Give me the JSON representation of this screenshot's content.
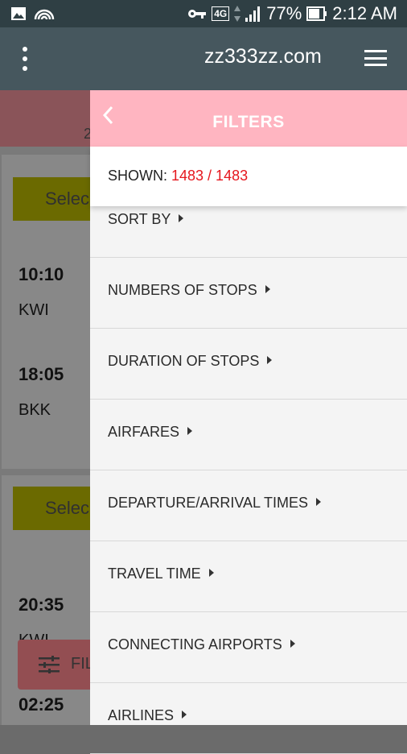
{
  "status_bar": {
    "battery": "77%",
    "time": "2:12 AM",
    "network": "4G"
  },
  "app_bar": {
    "title": "zz333zz.com"
  },
  "background": {
    "select_label": "Selec",
    "flights": [
      {
        "time": "10:10",
        "code": "KWI"
      },
      {
        "time": "18:05",
        "code": "BKK"
      },
      {
        "time": "20:35",
        "code": "KWI"
      },
      {
        "time": "02:25",
        "code": ""
      }
    ],
    "fab_label": "FIL",
    "date_fragment": "2"
  },
  "drawer": {
    "title": "FILTERS",
    "shown_label": "SHOWN:",
    "shown_value": "1483 / 1483",
    "items": [
      {
        "label": "SORT BY"
      },
      {
        "label": "NUMBERS OF STOPS"
      },
      {
        "label": "DURATION OF STOPS"
      },
      {
        "label": "AIRFARES"
      },
      {
        "label": "DEPARTURE/ARRIVAL TIMES"
      },
      {
        "label": "TRAVEL TIME"
      },
      {
        "label": "CONNECTING AIRPORTS"
      },
      {
        "label": "AIRLINES"
      }
    ]
  },
  "colors": {
    "accent_pink": "#ffb5c1",
    "count_red": "#e5161d",
    "app_bar": "#46575e"
  }
}
